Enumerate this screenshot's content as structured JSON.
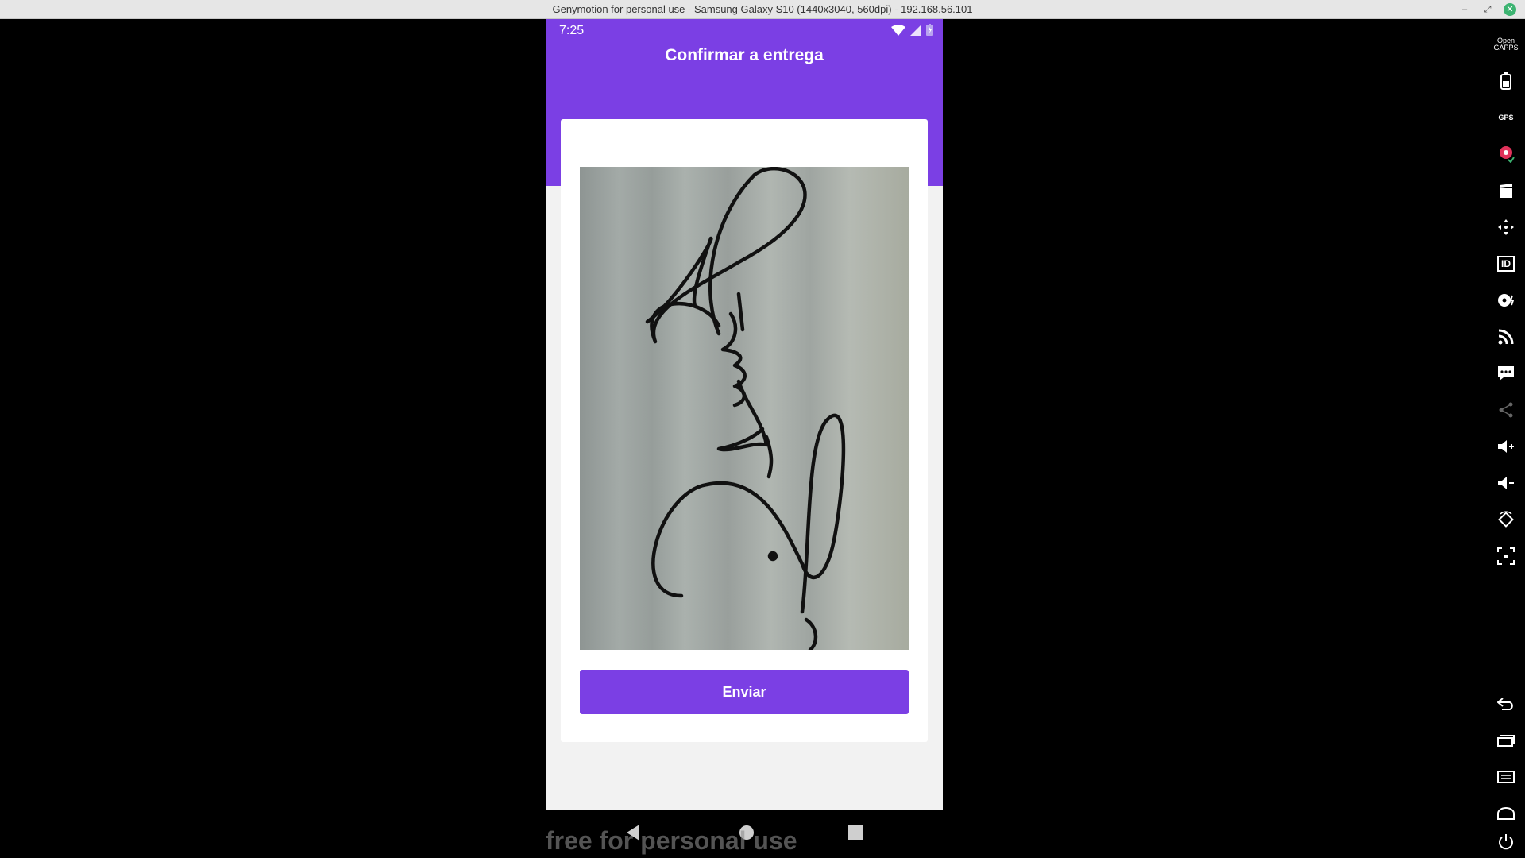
{
  "window": {
    "title": "Genymotion for personal use - Samsung Galaxy S10 (1440x3040, 560dpi) - 192.168.56.101",
    "min_glyph": "–",
    "restore_glyph": "⤢",
    "close_glyph": "✕"
  },
  "status_bar": {
    "time": "7:25"
  },
  "screen": {
    "title": "Confirmar a entrega",
    "send_label": "Enviar"
  },
  "watermark": "free for personal use",
  "toolbar": {
    "open_gapps": "Open GAPPS",
    "gps": "GPS",
    "id": "ID"
  },
  "colors": {
    "accent": "#7b3fe4",
    "background": "#f2f2f2"
  }
}
